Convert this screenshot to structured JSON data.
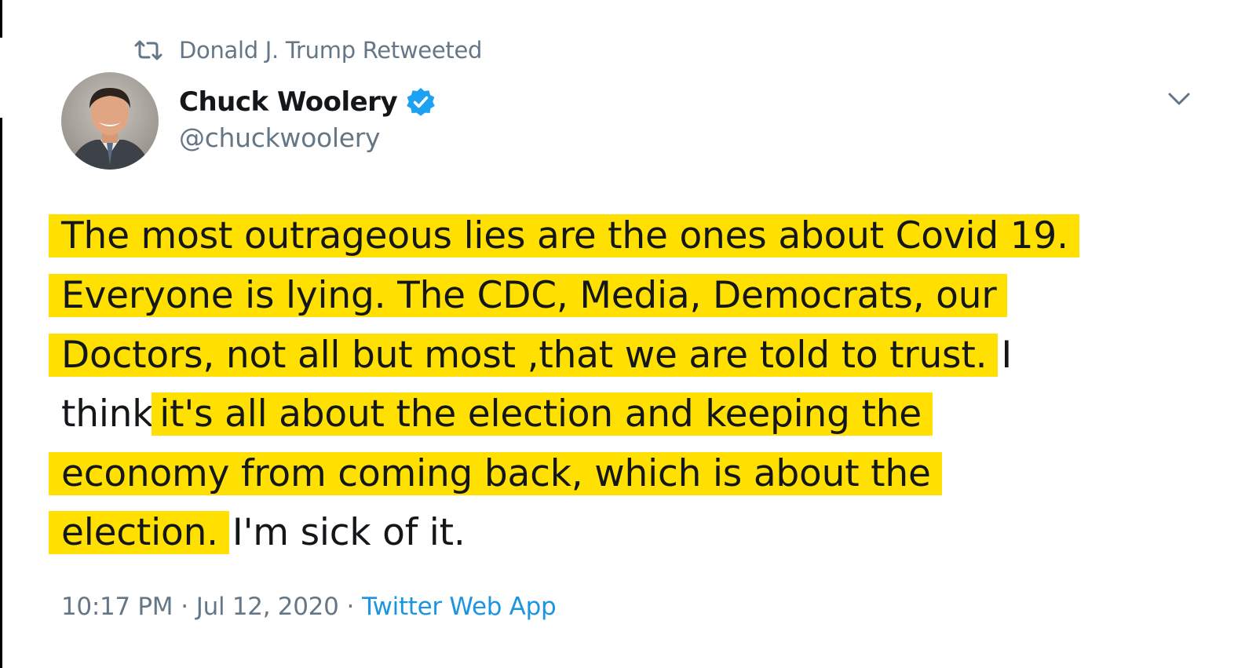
{
  "retweet_context": {
    "icon": "retweet-icon",
    "text": "Donald J. Trump Retweeted"
  },
  "author": {
    "display_name": "Chuck Woolery",
    "handle": "@chuckwoolery",
    "verified_icon": "verified-badge-icon",
    "verified_color": "#1da1f2"
  },
  "tweet": {
    "lines": [
      {
        "highlighted": "The most outrageous lies are the ones about Covid 19."
      },
      {
        "highlighted": "Everyone is lying. The CDC, Media, Democrats, our"
      },
      {
        "highlighted": "Doctors, not all but most ,that we are told to trust.",
        "plain": "I"
      },
      {
        "plain": "think",
        "highlighted": "it's all about the election and keeping the"
      },
      {
        "highlighted": "economy from coming back, which is about the"
      },
      {
        "highlighted": "election.",
        "plain": "I'm sick of it."
      }
    ],
    "highlight_color": "#ffe000"
  },
  "meta": {
    "time": "10:17 PM",
    "separator": "·",
    "date": "Jul 12, 2020",
    "source": "Twitter Web App",
    "source_color": "#1b95e0"
  },
  "menu": {
    "icon": "chevron-down-icon"
  }
}
